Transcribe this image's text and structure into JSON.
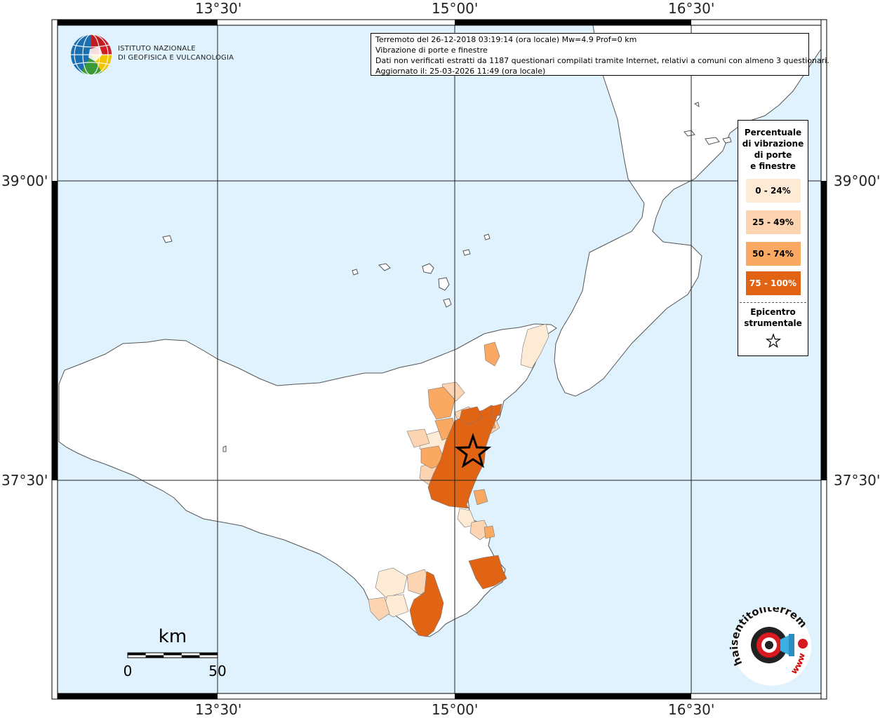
{
  "header": {
    "line1": "Terremoto del 26-12-2018 03:19:14 (ora locale) Mw=4.9 Prof=0 km",
    "line2": "Vibrazione di porte e finestre",
    "line3": "Dati non verificati estratti da 1187 questionari compilati tramite Internet, relativi a comuni con almeno 3 questionari.",
    "line4": "Aggiornato il: 25-03-2026 11:49 (ora locale)"
  },
  "institution": {
    "name_line1": "ISTITUTO NAZIONALE",
    "name_line2": "DI GEOFISICA E VULCANOLOGIA"
  },
  "legend": {
    "title_lines": [
      "Percentuale",
      "di vibrazione",
      "di porte",
      "e finestre"
    ],
    "classes": [
      {
        "label": "0 - 24%",
        "color": "#fdebd6"
      },
      {
        "label": "25 - 49%",
        "color": "#fcd4b2"
      },
      {
        "label": "50 - 74%",
        "color": "#f9a962"
      },
      {
        "label": "75 - 100%",
        "color": "#e06414"
      }
    ],
    "epicenter_lines": [
      "Epicentro",
      "strumentale"
    ]
  },
  "axes": {
    "top_labels": [
      "13°30'",
      "15°00'",
      "16°30'"
    ],
    "bottom_labels": [
      "13°30'",
      "15°00'",
      "16°30'"
    ],
    "left_labels": [
      "39°00'",
      "37°30'"
    ],
    "right_labels": [
      "39°00'",
      "37°30'"
    ]
  },
  "scale": {
    "unit": "km",
    "start": "0",
    "end": "50"
  },
  "logo2": {
    "text": "haisentitoilterremoto.it",
    "url_text": "www."
  },
  "colors": {
    "sea": "#e0f2fd",
    "land": "#ffffff"
  }
}
